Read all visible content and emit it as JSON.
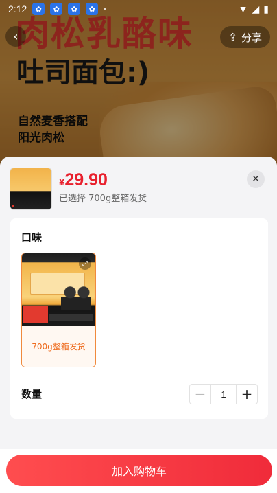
{
  "status_bar": {
    "time": "2:12"
  },
  "banner": {
    "headline": "肉松乳酪味",
    "headline2": "吐司面包:)",
    "sub1": "自然麦香搭配",
    "sub2": "阳光肉松"
  },
  "share": {
    "label": "分享"
  },
  "product": {
    "currency": "¥",
    "price": "29.90",
    "selected_text": "已选择 700g整箱发货"
  },
  "flavor": {
    "title": "口味",
    "options": [
      {
        "label": "700g整箱发货",
        "selected": true
      }
    ]
  },
  "quantity": {
    "title": "数量",
    "value": "1"
  },
  "footer": {
    "add_to_cart": "加入购物车"
  },
  "colors": {
    "accent": "#f02b3a",
    "variant_border": "#f08a3e"
  }
}
